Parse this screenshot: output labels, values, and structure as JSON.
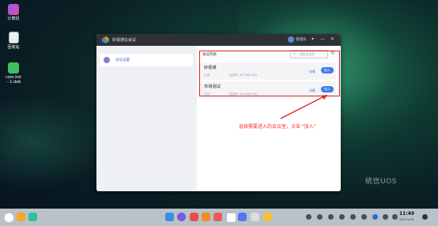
{
  "desktop": {
    "icons": [
      {
        "label": "计算机",
        "icon": "computer-icon"
      },
      {
        "label": "回收站",
        "icon": "trash-icon"
      },
      {
        "label": "com.hst\n···1.deb",
        "icon": "deb-package-icon"
      }
    ],
    "watermark": "统信UOS"
  },
  "window": {
    "title": "好视通云会议",
    "user_name": "管理员",
    "sidebar": {
      "items": [
        {
          "label": "会议设置",
          "icon": "meeting-settings-icon"
        }
      ]
    },
    "main": {
      "list_title": "会议列表",
      "search_placeholder": "搜索会议室",
      "rooms": [
        {
          "name": "好视通",
          "meta": "主持",
          "room_id": "会议号: 007-563-001",
          "detail_label": "详情",
          "join_label": "加入"
        },
        {
          "name": "市场测试",
          "meta": "主持",
          "room_id": "会议号: 414-066-181",
          "detail_label": "详情",
          "join_label": "加入"
        }
      ]
    }
  },
  "annotation": {
    "callout_text": "选择需要进入的会议室，点击 \"加入\"",
    "color": "#e02020"
  },
  "taskbar": {
    "time": "11:49",
    "date": "2021/1/18"
  }
}
